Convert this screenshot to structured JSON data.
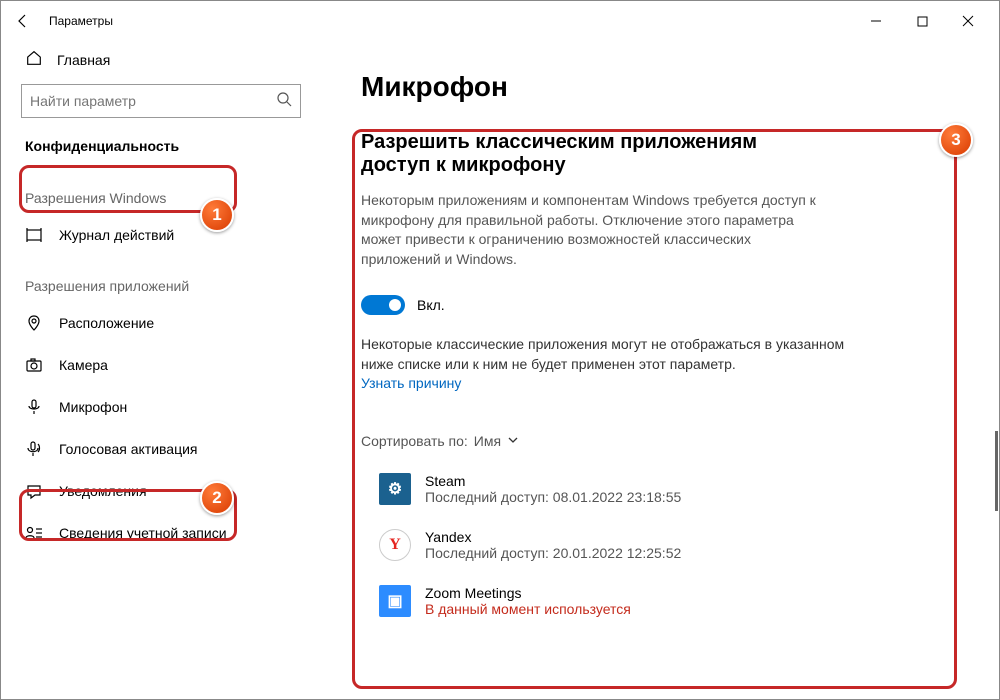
{
  "titlebar": {
    "title": "Параметры"
  },
  "sidebar": {
    "home": "Главная",
    "search_placeholder": "Найти параметр",
    "section": "Конфиденциальность",
    "group1": "Разрешения Windows",
    "group2": "Разрешения приложений",
    "items1": [
      {
        "label": "Журнал действий"
      }
    ],
    "items2": [
      {
        "label": "Расположение"
      },
      {
        "label": "Камера"
      },
      {
        "label": "Микрофон"
      },
      {
        "label": "Голосовая активация"
      },
      {
        "label": "Уведомления"
      },
      {
        "label": "Сведения учетной записи"
      }
    ]
  },
  "content": {
    "page_title": "Микрофон",
    "sub_title": "Разрешить классическим приложениям доступ к микрофону",
    "desc": "Некоторым приложениям и компонентам Windows требуется доступ к микрофону для правильной работы. Отключение этого параметра может привести к ограничению возможностей классических приложений и Windows.",
    "toggle_label": "Вкл.",
    "note": "Некоторые классические приложения могут не отображаться в указанном ниже списке или к ним не будет применен этот параметр.",
    "learn_more": "Узнать причину",
    "sort_label": "Сортировать по:",
    "sort_value": "Имя",
    "apps": [
      {
        "name": "Steam",
        "sub": "Последний доступ: 08.01.2022 23:18:55",
        "kind": "steam",
        "glyph": "⚙"
      },
      {
        "name": "Yandex",
        "sub": "Последний доступ: 20.01.2022 12:25:52",
        "kind": "yandex",
        "glyph": "Y"
      },
      {
        "name": "Zoom Meetings",
        "sub": "В данный момент используется",
        "kind": "zoom",
        "active": true,
        "glyph": "▣"
      }
    ]
  },
  "badges": {
    "b1": "1",
    "b2": "2",
    "b3": "3"
  }
}
